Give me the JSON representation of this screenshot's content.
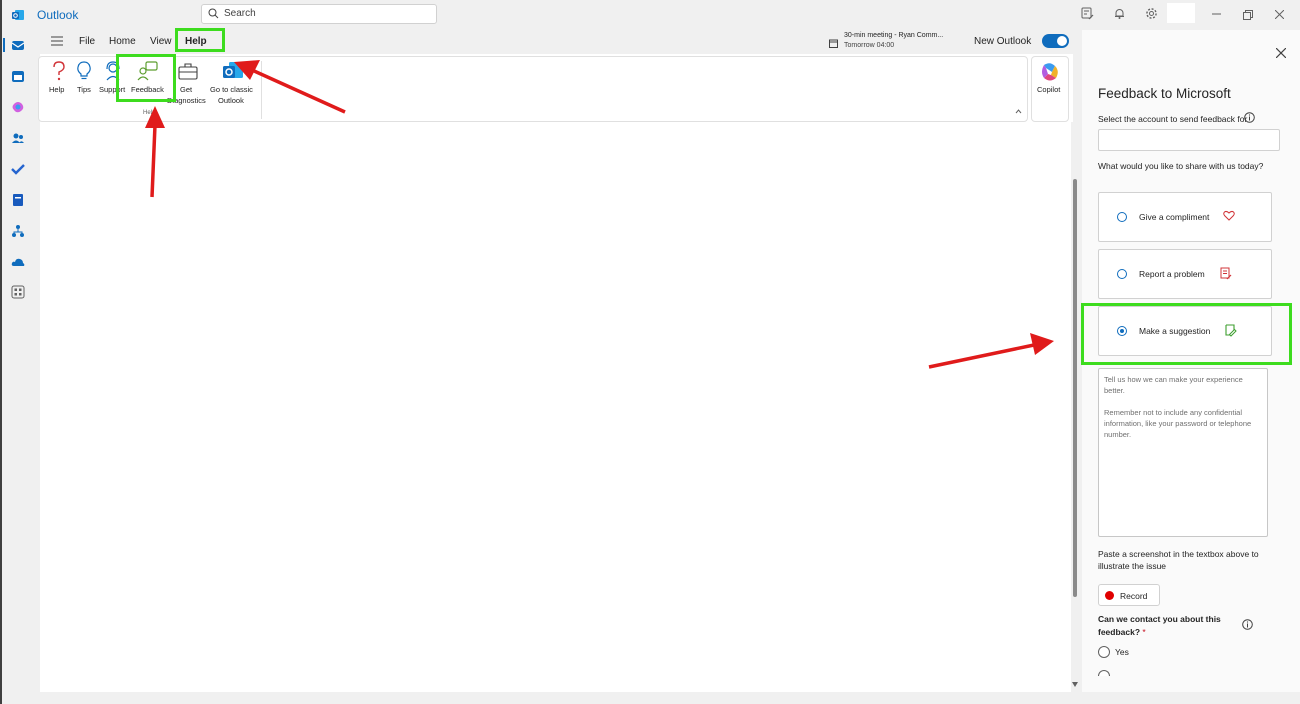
{
  "app": {
    "name": "Outlook"
  },
  "search": {
    "label": "Search"
  },
  "menu": {
    "file": "File",
    "home": "Home",
    "view": "View",
    "help": "Help"
  },
  "meeting": {
    "title": "30-min meeting - Ryan Comm...",
    "time": "Tomorrow 04:00"
  },
  "new_outlook": {
    "label": "New Outlook",
    "enabled": true
  },
  "ribbon": {
    "help": "Help",
    "tips": "Tips",
    "support": "Support",
    "feedback": "Feedback",
    "get_diagnostics_1": "Get",
    "get_diagnostics_2": "Diagnostics",
    "classic_1": "Go to classic",
    "classic_2": "Outlook",
    "group_label": "Help",
    "copilot": "Copilot"
  },
  "panel": {
    "title": "Feedback to Microsoft",
    "account_label": "Select the account to send feedback for",
    "share_label": "What would you like to share with us today?",
    "options": [
      {
        "label": "Give a compliment",
        "icon": "heart-icon",
        "selected": false
      },
      {
        "label": "Report a problem",
        "icon": "report-problem-icon",
        "selected": false
      },
      {
        "label": "Make a suggestion",
        "icon": "suggestion-note-icon",
        "selected": true
      }
    ],
    "textarea_placeholder_1": "Tell us how we can make your experience better.",
    "textarea_placeholder_2": "Remember not to include any confidential information, like your password or telephone number.",
    "screenshot_hint": "Paste a screenshot in the textbox above to illustrate the issue",
    "record_label": "Record",
    "contact_question": "Can we contact you about this feedback?",
    "contact_required_mark": "*",
    "contact_yes": "Yes"
  },
  "colors": {
    "accent": "#0f6cbd",
    "highlight": "#3ddc1e",
    "annotation_arrow": "#e01b1b"
  }
}
